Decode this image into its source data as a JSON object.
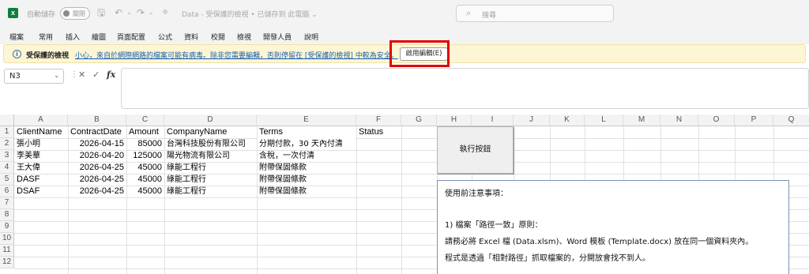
{
  "titlebar": {
    "app_icon": "excel-icon",
    "autosave_label": "自動儲存",
    "autosave_state": "關閉",
    "doc_title": "Data  -  受保護的檢視  •  已儲存到 此電腦  ⌄",
    "search_placeholder": "搜尋"
  },
  "tabs": [
    "檔案",
    "常用",
    "插入",
    "繪圖",
    "頁面配置",
    "公式",
    "資料",
    "校閱",
    "檢視",
    "開發人員",
    "說明"
  ],
  "protected_view": {
    "title": "受保護的檢視",
    "message": "小心，來自於網際網路的檔案可能有病毒。除非您需要編輯，否則停留在 [受保護的檢視] 中較為安全。",
    "enable_button": "啟用編輯(E)"
  },
  "formula_bar": {
    "cell_ref": "N3",
    "value": ""
  },
  "columns": [
    "A",
    "B",
    "C",
    "D",
    "E",
    "F",
    "G",
    "H",
    "I",
    "J",
    "K",
    "L",
    "M",
    "N",
    "O",
    "P",
    "Q"
  ],
  "rows": [
    "1",
    "2",
    "3",
    "4",
    "5",
    "6",
    "7",
    "8",
    "9",
    "10",
    "11",
    "12"
  ],
  "table": {
    "headers": [
      "ClientName",
      "ContractDate",
      "Amount",
      "CompanyName",
      "Terms",
      "Status"
    ],
    "records": [
      [
        "張小明",
        "2026-04-15",
        "85000",
        "台灣科技股份有限公司",
        "分期付款，30 天內付清",
        ""
      ],
      [
        "李美華",
        "2026-04-20",
        "125000",
        "陽光物流有限公司",
        "含稅，一次付清",
        ""
      ],
      [
        "王大偉",
        "2026-04-25",
        "45000",
        "綠能工程行",
        "附帶保固條款",
        ""
      ],
      [
        "DASF",
        "2026-04-25",
        "45000",
        "綠能工程行",
        "附帶保固條款",
        ""
      ],
      [
        "DSAF",
        "2026-04-25",
        "45000",
        "綠能工程行",
        "附帶保固條款",
        ""
      ]
    ]
  },
  "run_button": "執行按鈕",
  "notes": {
    "title": "使用前注意事項：",
    "blank": "",
    "rule1_title": "1) 檔案「路徑一致」原則：",
    "rule1_line1": "請務必將 Excel 檔 (Data.xlsm)、Word 模板 (Template.docx) 放在同一個資料夾內。",
    "rule1_line2": "程式是透過「相對路徑」抓取檔案的，分開放會找不到人。"
  },
  "colors": {
    "ribbon_bg": "#f3f3f3",
    "protected_bar_bg": "#fdf6d4",
    "highlight": "#e00000",
    "link": "#1b5fb0"
  }
}
